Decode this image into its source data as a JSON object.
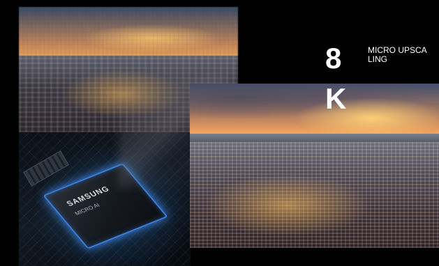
{
  "overlay": {
    "resolution_number": "8",
    "resolution_unit": "K",
    "feature_label": "MICRO UPSCALING"
  },
  "chip": {
    "brand": "SAMSUNG",
    "model": "MICRO AI"
  },
  "colors": {
    "background": "#000000",
    "chip_glow": "#3a7fe0",
    "text": "#ffffff"
  }
}
